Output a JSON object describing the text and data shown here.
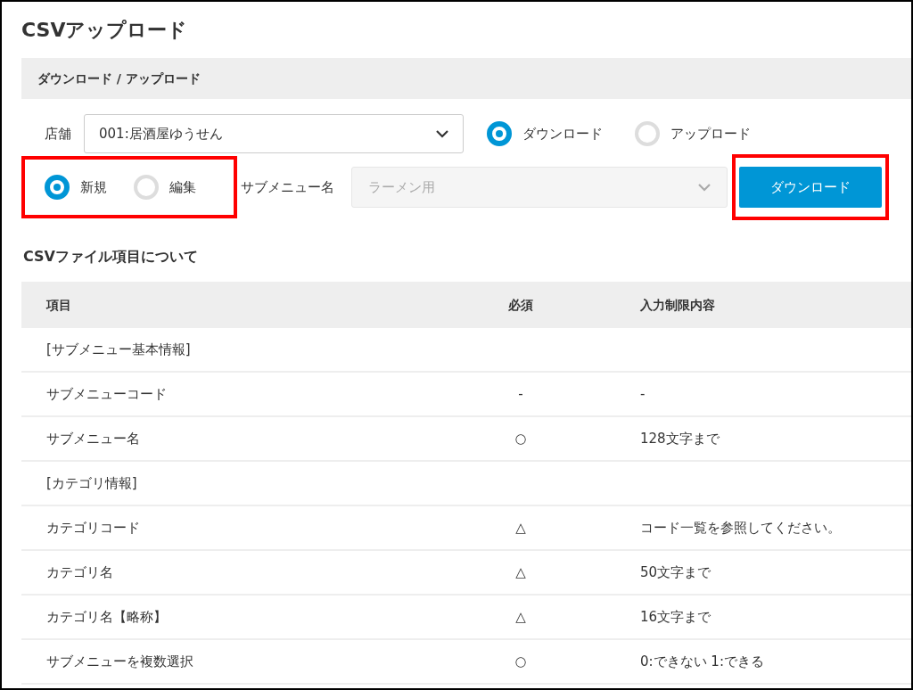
{
  "title": "CSVアップロード",
  "section": {
    "title": "ダウンロード / アップロード"
  },
  "store": {
    "label": "店舗",
    "value": "001:居酒屋ゆうせん"
  },
  "modes": [
    {
      "label": "ダウンロード",
      "selected": true
    },
    {
      "label": "アップロード",
      "selected": false
    }
  ],
  "types": {
    "highlighted": true,
    "options": [
      {
        "label": "新規",
        "selected": true
      },
      {
        "label": "編集",
        "selected": false
      }
    ]
  },
  "submenu": {
    "label": "サブメニュー名",
    "value": "ラーメン用",
    "disabled": true
  },
  "download_button": {
    "label": "ダウンロード",
    "highlighted": true
  },
  "table": {
    "title": "CSVファイル項目について",
    "columns": [
      "項目",
      "必須",
      "入力制限内容"
    ],
    "rows": [
      {
        "kind": "group",
        "cells": [
          "[サブメニュー基本情報]"
        ]
      },
      {
        "kind": "item",
        "cells": [
          "サブメニューコード",
          "-",
          "-"
        ]
      },
      {
        "kind": "item",
        "cells": [
          "サブメニュー名",
          "○",
          "128文字まで"
        ]
      },
      {
        "kind": "group",
        "cells": [
          "[カテゴリ情報]"
        ]
      },
      {
        "kind": "item",
        "cells": [
          "カテゴリコード",
          "△",
          "コード一覧を参照してください。"
        ]
      },
      {
        "kind": "item",
        "cells": [
          "カテゴリ名",
          "△",
          "50文字まで"
        ]
      },
      {
        "kind": "item",
        "cells": [
          "カテゴリ名【略称】",
          "△",
          "16文字まで"
        ]
      },
      {
        "kind": "item",
        "cells": [
          "サブメニューを複数選択",
          "○",
          "0:できない 1:できる"
        ]
      }
    ]
  }
}
